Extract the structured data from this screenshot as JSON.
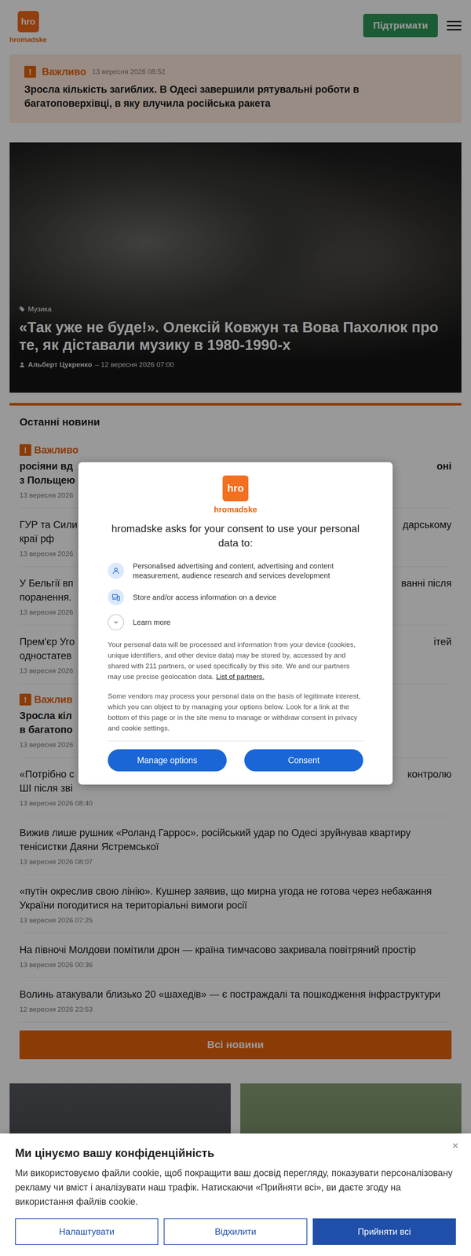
{
  "header": {
    "logo_mark": "hro",
    "logo_word": "hromadske",
    "support_button": "Підтримати"
  },
  "alert": {
    "icon": "!",
    "label": "Важливо",
    "time": "13 вересня 2026 08:52",
    "title": "Зросла кількість загиблих. В Одесі завершили рятувальні роботи в багатоповерхівці, в яку влучила російська ракета"
  },
  "hero": {
    "category": "Музика",
    "title": "«Так уже не буде!». Олексій Ковжун та Вова Пахолюк про те, як діставали музику в 1980-1990-х",
    "author": "Альберт Цукренко",
    "meta": "– 12 вересня 2026 07:00"
  },
  "latest": {
    "title": "Останні новини",
    "items": [
      {
        "kind": "covered",
        "important": true,
        "icon": "!",
        "label": "Важливо",
        "lines": [
          {
            "left": "росіяни вд",
            "right": "оні"
          },
          {
            "left": "з Польщею"
          }
        ],
        "time": "13 вересня 2026"
      },
      {
        "kind": "covered",
        "important": false,
        "lines": [
          {
            "left": "ГУР та Сили",
            "right": "дарському"
          },
          {
            "left": "краї рф"
          }
        ],
        "time": "13 вересня 2026"
      },
      {
        "kind": "covered",
        "important": false,
        "lines": [
          {
            "left": "У Бельгії вп",
            "right": "ванні після"
          },
          {
            "left": "поранення."
          }
        ],
        "time": "13 вересня 2026"
      },
      {
        "kind": "covered",
        "important": false,
        "lines": [
          {
            "left": "Прем'єр Уго",
            "right": "ітей"
          },
          {
            "left": "одностатев"
          }
        ],
        "time": "13 вересня 2026"
      },
      {
        "kind": "covered",
        "important": true,
        "icon": "!",
        "label": "Важлив",
        "lines": [
          {
            "left": "Зросла кіл"
          },
          {
            "left": "в багатопо"
          }
        ],
        "time": "13 вересня 2026"
      },
      {
        "kind": "covered",
        "important": false,
        "lines": [
          {
            "left": "«Потрібно с",
            "right": "контролю"
          },
          {
            "left": "ШІ після зві"
          }
        ],
        "time": "13 вересня 2026 08:40"
      },
      {
        "kind": "full",
        "important": false,
        "title": "Вижив лише рушник «Роланд Гаррос». російський удар по Одесі зруйнував квартиру тенісистки Даяни Ястремської",
        "time": "13 вересня 2026 08:07"
      },
      {
        "kind": "full",
        "important": false,
        "title": "«путін окреслив свою лінію». Кушнер заявив, що мирна угода не готова через небажання України погодитися на територіальні вимоги росії",
        "time": "13 вересня 2026 07:25"
      },
      {
        "kind": "full",
        "important": false,
        "title": "На півночі Молдови помітили дрон — країна тимчасово закривала повітряний простір",
        "time": "13 вересня 2026 00:36"
      },
      {
        "kind": "full",
        "important": false,
        "title": "Волинь атакували близько 20 «шахедів» — є постраждалі та пошкодження інфраструктури",
        "time": "12 вересня 2026 23:53"
      }
    ],
    "all_button": "Всі новини"
  },
  "modal": {
    "logo_mark": "hro",
    "logo_word": "hromadske",
    "heading": "hromadske asks for your consent to use your personal data to:",
    "purposes": [
      {
        "text": "Personalised advertising and content, advertising and content measurement, audience research and services development"
      },
      {
        "text": "Store and/or access information on a device"
      }
    ],
    "learn_more": "Learn more",
    "paragraph1": "Your personal data will be processed and information from your device (cookies, unique identifiers, and other device data) may be stored by, accessed by and shared with 211 partners, or used specifically by this site. We and our partners may use precise geolocation data.",
    "partners_link": "List of partners.",
    "paragraph2": "Some vendors may process your personal data on the basis of legitimate interest, which you can object to by managing your options below. Look for a link at the bottom of this page or in the site menu to manage or withdraw consent in privacy and cookie settings.",
    "buttons": [
      "Manage options",
      "Consent"
    ]
  },
  "cookie_banner": {
    "title": "Ми цінуємо вашу конфіденційність",
    "text": "Ми використовуємо файли cookie, щоб покращити ваш досвід перегляду, показувати персоналізовану рекламу чи вміст і аналізувати наш трафік. Натискаючи «Прийняти всі», ви даєте згоду на використання файлів cookie.",
    "close": "×",
    "buttons": [
      {
        "label": "Налаштувати",
        "kind": "outline"
      },
      {
        "label": "Відхилити",
        "kind": "outline"
      },
      {
        "label": "Прийняти всі",
        "kind": "filled"
      }
    ]
  }
}
